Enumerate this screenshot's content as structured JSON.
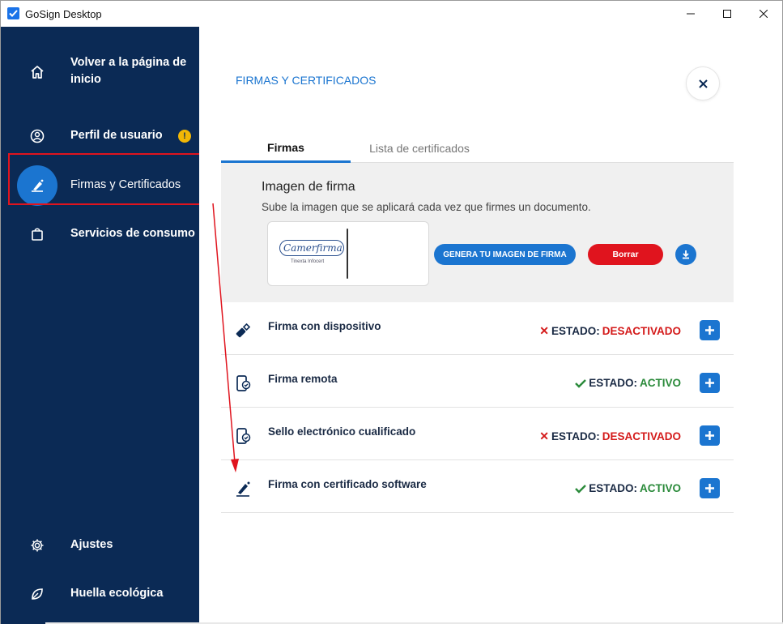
{
  "window": {
    "title": "GoSign Desktop",
    "accent": "#1b75d0",
    "sidebar_bg": "#0b2a55"
  },
  "sidebar": {
    "items": [
      {
        "label": "Volver a la página de inicio",
        "icon": "home-icon"
      },
      {
        "label": "Perfil de usuario",
        "icon": "user-icon",
        "badge": "!"
      },
      {
        "label": "Firmas y Certificados",
        "icon": "signature-pen-icon",
        "active": true
      },
      {
        "label": "Servicios de consumo",
        "icon": "shopping-bag-icon"
      },
      {
        "label": "Ajustes",
        "icon": "gear-icon"
      },
      {
        "label": "Huella ecológica",
        "icon": "leaf-icon"
      }
    ]
  },
  "main": {
    "title": "FIRMAS Y CERTIFICADOS",
    "tabs": [
      {
        "label": "Firmas",
        "active": true
      },
      {
        "label": "Lista de certificados",
        "active": false
      }
    ],
    "signature": {
      "heading": "Imagen de firma",
      "description": "Sube la imagen que se aplicará cada vez que firmes un documento.",
      "logo_text": "Camerfirma",
      "logo_subtext": "Tinexta Infocert",
      "generate_label": "GENERA TU IMAGEN DE FIRMA",
      "delete_label": "Borrar"
    },
    "rows": [
      {
        "label": "Firma con dispositivo",
        "status_prefix": "ESTADO:",
        "status": "DESACTIVADO",
        "active": false,
        "icon": "usb-key-icon"
      },
      {
        "label": "Firma remota",
        "status_prefix": "ESTADO:",
        "status": "ACTIVO",
        "active": true,
        "icon": "phone-check-icon"
      },
      {
        "label": "Sello electrónico cualificado",
        "status_prefix": "ESTADO:",
        "status": "DESACTIVADO",
        "active": false,
        "icon": "phone-check-icon"
      },
      {
        "label": "Firma con certificado software",
        "status_prefix": "ESTADO:",
        "status": "ACTIVO",
        "active": true,
        "icon": "signature-pen-icon"
      }
    ]
  },
  "colors": {
    "active": "#2a8a3a",
    "inactive": "#d41a1a",
    "highlight": "#e0141e"
  }
}
